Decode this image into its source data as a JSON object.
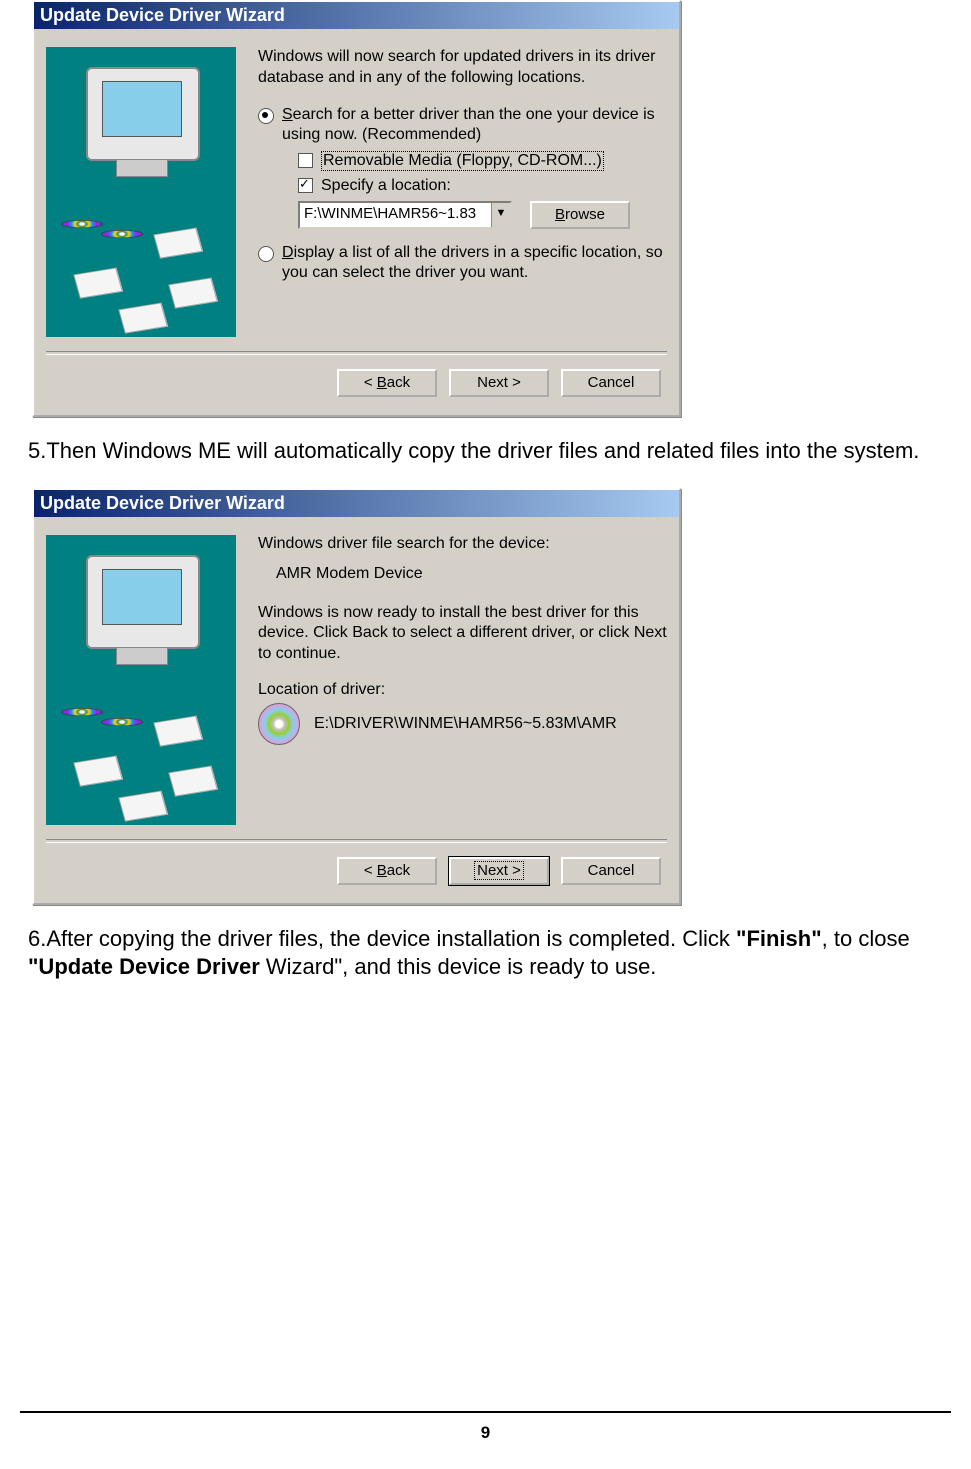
{
  "dialog1": {
    "title": "Update Device Driver Wizard",
    "intro": "Windows will now search for updated drivers in its driver database and in any of the following locations.",
    "opt1_a": "S",
    "opt1_b": "earch for a better driver than the one your device is using now. (Recommended)",
    "chk1_a": "Removable ",
    "chk1_m": "M",
    "chk1_b": "edia (Floppy, CD-ROM...)",
    "chk2": "Specify a location:",
    "path": "F:\\WINME\\HAMR56~1.83",
    "browse_a": "B",
    "browse_b": "rowse",
    "opt2_a": "D",
    "opt2_b": "isplay a list of all the drivers in a specific location, so you can select the driver you want.",
    "back_a": "< ",
    "back_u": "B",
    "back_b": "ack",
    "next": "Next >",
    "cancel": "Cancel"
  },
  "step5": {
    "num": "5.",
    "text": "Then   Windows ME will automatically copy the driver files and related files into the system."
  },
  "dialog2": {
    "title": "Update Device Driver Wizard",
    "line1": "Windows driver file search for the device:",
    "device": "AMR Modem Device",
    "line2": "Windows is now ready to install the best driver for this device. Click Back to select a different driver, or click Next to continue.",
    "locLabel": "Location of driver:",
    "locPath": "E:\\DRIVER\\WINME\\HAMR56~5.83M\\AMR",
    "back_a": "< ",
    "back_u": "B",
    "back_b": "ack",
    "next": "Next >",
    "cancel": "Cancel"
  },
  "step6": {
    "num": "6.",
    "t1": "After copying the driver files, the device installation is completed. Click ",
    "b1": "\"Finish\"",
    "t2": ", to close ",
    "b2": "\"Update Device Driver",
    "t3": " Wizard\", and this device is ready to use."
  },
  "pageNumber": "9"
}
